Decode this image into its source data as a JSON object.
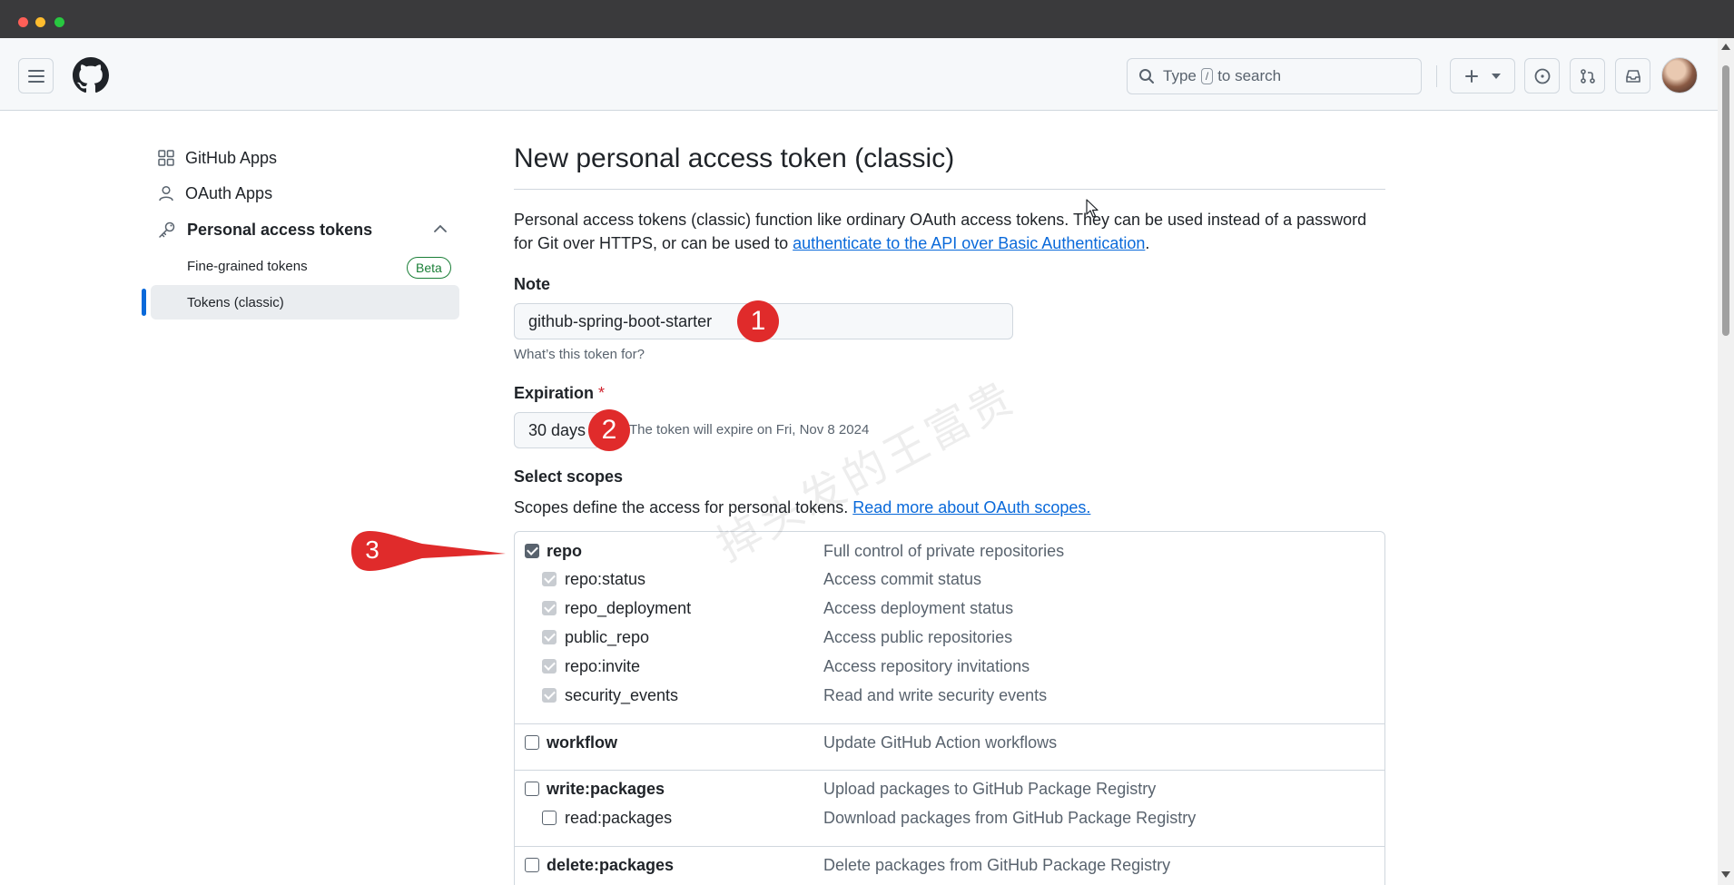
{
  "header": {
    "search_prefix": "Type",
    "search_key": "/",
    "search_suffix": "to search"
  },
  "sidebar": {
    "items": [
      {
        "label": "GitHub Apps"
      },
      {
        "label": "OAuth Apps"
      },
      {
        "label": "Personal access tokens"
      }
    ],
    "sub_items": [
      {
        "label": "Fine-grained tokens",
        "badge": "Beta"
      },
      {
        "label": "Tokens (classic)"
      }
    ]
  },
  "main": {
    "title": "New personal access token (classic)",
    "intro_text": "Personal access tokens (classic) function like ordinary OAuth access tokens. They can be used instead of a password for Git over HTTPS, or can be used to ",
    "intro_link": "authenticate to the API over Basic Authentication",
    "intro_end": ".",
    "note_label": "Note",
    "note_value": "github-spring-boot-starter",
    "note_hint": "What’s this token for?",
    "expiration_label": "Expiration",
    "expiration_required": "*",
    "expiration_value": "30 days",
    "expiration_note": "The token will expire on Fri, Nov 8 2024",
    "scopes_label": "Select scopes",
    "scopes_desc": "Scopes define the access for personal tokens.",
    "scopes_link": "Read more about OAuth scopes."
  },
  "scopes": {
    "repo": {
      "name": "repo",
      "desc": "Full control of private repositories",
      "checked": true
    },
    "repo_children": [
      {
        "name": "repo:status",
        "desc": "Access commit status"
      },
      {
        "name": "repo_deployment",
        "desc": "Access deployment status"
      },
      {
        "name": "public_repo",
        "desc": "Access public repositories"
      },
      {
        "name": "repo:invite",
        "desc": "Access repository invitations"
      },
      {
        "name": "security_events",
        "desc": "Read and write security events"
      }
    ],
    "workflow": {
      "name": "workflow",
      "desc": "Update GitHub Action workflows"
    },
    "write_packages": {
      "name": "write:packages",
      "desc": "Upload packages to GitHub Package Registry"
    },
    "read_packages": {
      "name": "read:packages",
      "desc": "Download packages from GitHub Package Registry"
    },
    "delete_packages": {
      "name": "delete:packages",
      "desc": "Delete packages from GitHub Package Registry"
    }
  },
  "annotations": {
    "badge1": "1",
    "badge2": "2",
    "badge3": "3",
    "watermark": "掉头发的王富贵"
  },
  "colors": {
    "accent": "#0969da",
    "annotation_red": "#e02b2b",
    "success": "#1a7f37"
  }
}
